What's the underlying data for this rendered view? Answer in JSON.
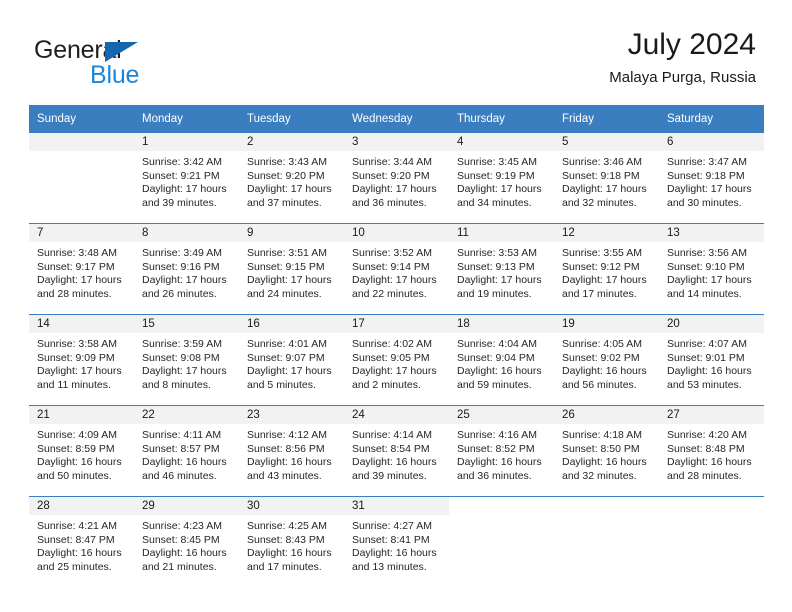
{
  "brand": {
    "name_top": "General",
    "name_bottom": "Blue",
    "triangle_color": "#1565b0",
    "blue_text_color": "#1a86d8"
  },
  "header": {
    "title": "July 2024",
    "subtitle": "Malaya Purga, Russia"
  },
  "theme": {
    "header_blue": "#3a7ebf",
    "daynum_band": "#f2f2f2",
    "text": "#1a1a1a"
  },
  "weekdays": [
    "Sunday",
    "Monday",
    "Tuesday",
    "Wednesday",
    "Thursday",
    "Friday",
    "Saturday"
  ],
  "weeks": [
    [
      {
        "day": "",
        "lines": []
      },
      {
        "day": "1",
        "lines": [
          "Sunrise: 3:42 AM",
          "Sunset: 9:21 PM",
          "Daylight: 17 hours",
          "and 39 minutes."
        ]
      },
      {
        "day": "2",
        "lines": [
          "Sunrise: 3:43 AM",
          "Sunset: 9:20 PM",
          "Daylight: 17 hours",
          "and 37 minutes."
        ]
      },
      {
        "day": "3",
        "lines": [
          "Sunrise: 3:44 AM",
          "Sunset: 9:20 PM",
          "Daylight: 17 hours",
          "and 36 minutes."
        ]
      },
      {
        "day": "4",
        "lines": [
          "Sunrise: 3:45 AM",
          "Sunset: 9:19 PM",
          "Daylight: 17 hours",
          "and 34 minutes."
        ]
      },
      {
        "day": "5",
        "lines": [
          "Sunrise: 3:46 AM",
          "Sunset: 9:18 PM",
          "Daylight: 17 hours",
          "and 32 minutes."
        ]
      },
      {
        "day": "6",
        "lines": [
          "Sunrise: 3:47 AM",
          "Sunset: 9:18 PM",
          "Daylight: 17 hours",
          "and 30 minutes."
        ]
      }
    ],
    [
      {
        "day": "7",
        "lines": [
          "Sunrise: 3:48 AM",
          "Sunset: 9:17 PM",
          "Daylight: 17 hours",
          "and 28 minutes."
        ]
      },
      {
        "day": "8",
        "lines": [
          "Sunrise: 3:49 AM",
          "Sunset: 9:16 PM",
          "Daylight: 17 hours",
          "and 26 minutes."
        ]
      },
      {
        "day": "9",
        "lines": [
          "Sunrise: 3:51 AM",
          "Sunset: 9:15 PM",
          "Daylight: 17 hours",
          "and 24 minutes."
        ]
      },
      {
        "day": "10",
        "lines": [
          "Sunrise: 3:52 AM",
          "Sunset: 9:14 PM",
          "Daylight: 17 hours",
          "and 22 minutes."
        ]
      },
      {
        "day": "11",
        "lines": [
          "Sunrise: 3:53 AM",
          "Sunset: 9:13 PM",
          "Daylight: 17 hours",
          "and 19 minutes."
        ]
      },
      {
        "day": "12",
        "lines": [
          "Sunrise: 3:55 AM",
          "Sunset: 9:12 PM",
          "Daylight: 17 hours",
          "and 17 minutes."
        ]
      },
      {
        "day": "13",
        "lines": [
          "Sunrise: 3:56 AM",
          "Sunset: 9:10 PM",
          "Daylight: 17 hours",
          "and 14 minutes."
        ]
      }
    ],
    [
      {
        "day": "14",
        "lines": [
          "Sunrise: 3:58 AM",
          "Sunset: 9:09 PM",
          "Daylight: 17 hours",
          "and 11 minutes."
        ]
      },
      {
        "day": "15",
        "lines": [
          "Sunrise: 3:59 AM",
          "Sunset: 9:08 PM",
          "Daylight: 17 hours",
          "and 8 minutes."
        ]
      },
      {
        "day": "16",
        "lines": [
          "Sunrise: 4:01 AM",
          "Sunset: 9:07 PM",
          "Daylight: 17 hours",
          "and 5 minutes."
        ]
      },
      {
        "day": "17",
        "lines": [
          "Sunrise: 4:02 AM",
          "Sunset: 9:05 PM",
          "Daylight: 17 hours",
          "and 2 minutes."
        ]
      },
      {
        "day": "18",
        "lines": [
          "Sunrise: 4:04 AM",
          "Sunset: 9:04 PM",
          "Daylight: 16 hours",
          "and 59 minutes."
        ]
      },
      {
        "day": "19",
        "lines": [
          "Sunrise: 4:05 AM",
          "Sunset: 9:02 PM",
          "Daylight: 16 hours",
          "and 56 minutes."
        ]
      },
      {
        "day": "20",
        "lines": [
          "Sunrise: 4:07 AM",
          "Sunset: 9:01 PM",
          "Daylight: 16 hours",
          "and 53 minutes."
        ]
      }
    ],
    [
      {
        "day": "21",
        "lines": [
          "Sunrise: 4:09 AM",
          "Sunset: 8:59 PM",
          "Daylight: 16 hours",
          "and 50 minutes."
        ]
      },
      {
        "day": "22",
        "lines": [
          "Sunrise: 4:11 AM",
          "Sunset: 8:57 PM",
          "Daylight: 16 hours",
          "and 46 minutes."
        ]
      },
      {
        "day": "23",
        "lines": [
          "Sunrise: 4:12 AM",
          "Sunset: 8:56 PM",
          "Daylight: 16 hours",
          "and 43 minutes."
        ]
      },
      {
        "day": "24",
        "lines": [
          "Sunrise: 4:14 AM",
          "Sunset: 8:54 PM",
          "Daylight: 16 hours",
          "and 39 minutes."
        ]
      },
      {
        "day": "25",
        "lines": [
          "Sunrise: 4:16 AM",
          "Sunset: 8:52 PM",
          "Daylight: 16 hours",
          "and 36 minutes."
        ]
      },
      {
        "day": "26",
        "lines": [
          "Sunrise: 4:18 AM",
          "Sunset: 8:50 PM",
          "Daylight: 16 hours",
          "and 32 minutes."
        ]
      },
      {
        "day": "27",
        "lines": [
          "Sunrise: 4:20 AM",
          "Sunset: 8:48 PM",
          "Daylight: 16 hours",
          "and 28 minutes."
        ]
      }
    ],
    [
      {
        "day": "28",
        "lines": [
          "Sunrise: 4:21 AM",
          "Sunset: 8:47 PM",
          "Daylight: 16 hours",
          "and 25 minutes."
        ]
      },
      {
        "day": "29",
        "lines": [
          "Sunrise: 4:23 AM",
          "Sunset: 8:45 PM",
          "Daylight: 16 hours",
          "and 21 minutes."
        ]
      },
      {
        "day": "30",
        "lines": [
          "Sunrise: 4:25 AM",
          "Sunset: 8:43 PM",
          "Daylight: 16 hours",
          "and 17 minutes."
        ]
      },
      {
        "day": "31",
        "lines": [
          "Sunrise: 4:27 AM",
          "Sunset: 8:41 PM",
          "Daylight: 16 hours",
          "and 13 minutes."
        ]
      },
      {
        "day": "",
        "lines": [],
        "blank": true
      },
      {
        "day": "",
        "lines": [],
        "blank": true
      },
      {
        "day": "",
        "lines": [],
        "blank": true
      }
    ]
  ]
}
